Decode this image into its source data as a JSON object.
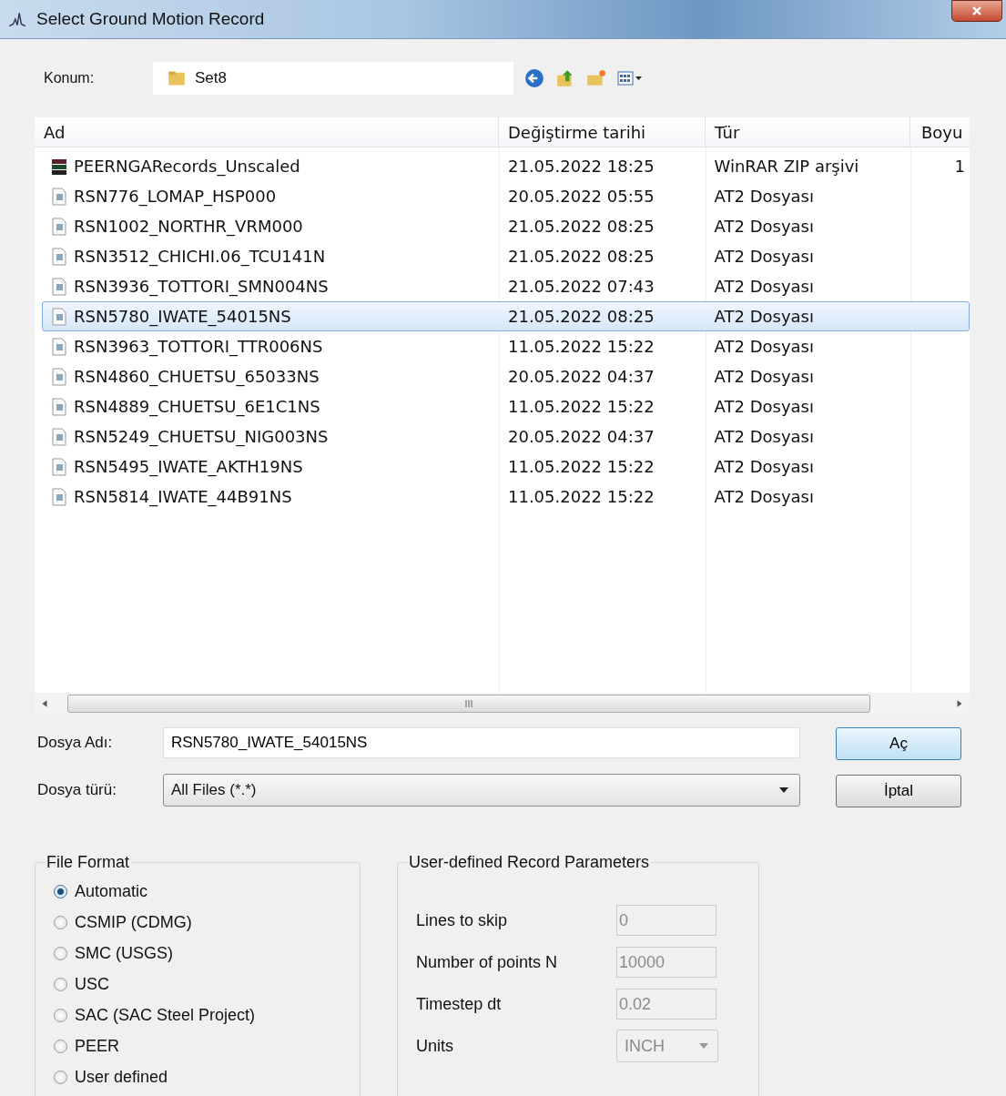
{
  "window": {
    "title": "Select Ground Motion Record"
  },
  "location": {
    "label": "Konum:",
    "folder": "Set8"
  },
  "file_list": {
    "columns": [
      "Ad",
      "Değiştirme tarihi",
      "Tür",
      "Boyu"
    ],
    "rows": [
      {
        "kind": "archive",
        "name": "PEERNGARecords_Unscaled",
        "date": "21.05.2022 18:25",
        "type": "WinRAR ZIP arşivi",
        "size": "1",
        "selected": false
      },
      {
        "kind": "document",
        "name": "RSN776_LOMAP_HSP000",
        "date": "20.05.2022 05:55",
        "type": "AT2 Dosyası",
        "selected": false
      },
      {
        "kind": "document",
        "name": "RSN1002_NORTHR_VRM000",
        "date": "21.05.2022 08:25",
        "type": "AT2 Dosyası",
        "selected": false
      },
      {
        "kind": "document",
        "name": "RSN3512_CHICHI.06_TCU141N",
        "date": "21.05.2022 08:25",
        "type": "AT2 Dosyası",
        "selected": false
      },
      {
        "kind": "document",
        "name": "RSN3936_TOTTORI_SMN004NS",
        "date": "21.05.2022 07:43",
        "type": "AT2 Dosyası",
        "selected": false
      },
      {
        "kind": "document",
        "name": "RSN5780_IWATE_54015NS",
        "date": "21.05.2022 08:25",
        "type": "AT2 Dosyası",
        "selected": true
      },
      {
        "kind": "document",
        "name": "RSN3963_TOTTORI_TTR006NS",
        "date": "11.05.2022 15:22",
        "type": "AT2 Dosyası",
        "selected": false
      },
      {
        "kind": "document",
        "name": "RSN4860_CHUETSU_65033NS",
        "date": "20.05.2022 04:37",
        "type": "AT2 Dosyası",
        "selected": false
      },
      {
        "kind": "document",
        "name": "RSN4889_CHUETSU_6E1C1NS",
        "date": "11.05.2022 15:22",
        "type": "AT2 Dosyası",
        "selected": false
      },
      {
        "kind": "document",
        "name": "RSN5249_CHUETSU_NIG003NS",
        "date": "20.05.2022 04:37",
        "type": "AT2 Dosyası",
        "selected": false
      },
      {
        "kind": "document",
        "name": "RSN5495_IWATE_AKTH19NS",
        "date": "11.05.2022 15:22",
        "type": "AT2 Dosyası",
        "selected": false
      },
      {
        "kind": "document",
        "name": "RSN5814_IWATE_44B91NS",
        "date": "11.05.2022 15:22",
        "type": "AT2 Dosyası",
        "selected": false
      }
    ],
    "scroll_grip": "III"
  },
  "file_name": {
    "label": "Dosya Adı:",
    "value": "RSN5780_IWATE_54015NS"
  },
  "file_type": {
    "label": "Dosya türü:",
    "value": "All Files (*.*)"
  },
  "buttons": [
    {
      "label": "Aç",
      "default": true
    },
    {
      "label": "İptal",
      "default": false
    }
  ],
  "file_format": {
    "title": "File Format",
    "options": [
      {
        "label": "Automatic",
        "selected": true
      },
      {
        "label": "CSMIP (CDMG)",
        "selected": false
      },
      {
        "label": "SMC (USGS)",
        "selected": false
      },
      {
        "label": "USC",
        "selected": false
      },
      {
        "label": "SAC (SAC Steel Project)",
        "selected": false
      },
      {
        "label": "PEER",
        "selected": false
      },
      {
        "label": "User defined",
        "selected": false
      }
    ]
  },
  "record_parameters": {
    "title": "User-defined Record Parameters",
    "fields": [
      {
        "kind": "text",
        "label": "Lines to skip",
        "value": "0",
        "disabled": true
      },
      {
        "kind": "text",
        "label": "Number of points N",
        "value": "10000",
        "disabled": true
      },
      {
        "kind": "text",
        "label": "Timestep dt",
        "value": "0.02",
        "disabled": true
      },
      {
        "kind": "select",
        "label": "Units",
        "value": "INCH",
        "disabled": true
      }
    ]
  }
}
